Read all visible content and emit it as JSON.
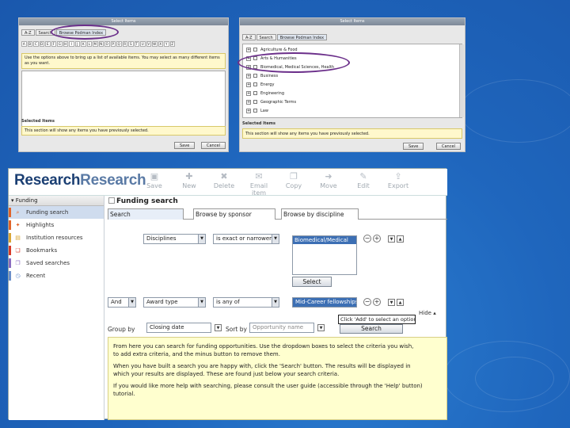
{
  "left_panel": {
    "title": "Select Items",
    "tabs": [
      "A-Z",
      "Search",
      "Browse Podman Index"
    ],
    "alphabet": [
      "A",
      "B",
      "C",
      "D",
      "E",
      "F",
      "G",
      "H",
      "I",
      "J",
      "K",
      "L",
      "M",
      "N",
      "O",
      "P",
      "Q",
      "R",
      "S",
      "T",
      "U",
      "V",
      "W",
      "X",
      "Y",
      "Z"
    ],
    "note": "Use the options above to bring up a list of available items. You may select as many different items as you want.",
    "selected_heading": "Selected Items",
    "selected_note": "This section will show any items you have previously selected.",
    "save_label": "Save",
    "cancel_label": "Cancel"
  },
  "right_panel": {
    "title": "Select Items",
    "tabs": [
      "A-Z",
      "Search",
      "Browse Podman Index"
    ],
    "tree_items": [
      "Agriculture & Food",
      "Arts & Humanities",
      "Biomedical, Medical Sciences, Health",
      "Business",
      "Energy",
      "Engineering",
      "Geographic Terms",
      "Law"
    ],
    "selected_heading": "Selected Items",
    "selected_note": "This section will show any items you have previously selected.",
    "save_label": "Save",
    "cancel_label": "Cancel"
  },
  "app": {
    "logo_main": "Research",
    "logo_second": "Research",
    "toolbar": [
      {
        "label": "Save",
        "icon": "save-icon",
        "glyph": "▣"
      },
      {
        "label": "New",
        "icon": "new-icon",
        "glyph": "✚"
      },
      {
        "label": "Delete",
        "icon": "delete-icon",
        "glyph": "✖"
      },
      {
        "label": "Email item",
        "icon": "email-icon",
        "glyph": "✉"
      },
      {
        "label": "Copy",
        "icon": "copy-icon",
        "glyph": "❐"
      },
      {
        "label": "Move",
        "icon": "move-icon",
        "glyph": "➜"
      },
      {
        "label": "Edit",
        "icon": "edit-icon",
        "glyph": "✎"
      },
      {
        "label": "Export",
        "icon": "export-icon",
        "glyph": "⇪"
      }
    ],
    "sidebar": {
      "heading": "Funding",
      "items": [
        {
          "label": "Funding search",
          "icon": "search-icon",
          "glyph": "⌕",
          "color": "#e0642a"
        },
        {
          "label": "Highlights",
          "icon": "highlight-icon",
          "glyph": "✦",
          "color": "#e0642a"
        },
        {
          "label": "Institution resources",
          "icon": "institution-icon",
          "glyph": "▤",
          "color": "#d8a636"
        },
        {
          "label": "Bookmarks",
          "icon": "bookmark-icon",
          "glyph": "❏",
          "color": "#d83b2a"
        },
        {
          "label": "Saved searches",
          "icon": "saved-search-icon",
          "glyph": "❐",
          "color": "#8b6cc0"
        },
        {
          "label": "Recent",
          "icon": "recent-icon",
          "glyph": "◷",
          "color": "#6b8fc9"
        }
      ]
    },
    "main": {
      "title": "Funding search",
      "tabs": [
        "Search",
        "Browse by sponsor",
        "Browse by discipline"
      ],
      "row1": {
        "field": "Disciplines",
        "operator": "is exact or narrower",
        "listbox_option": "Biomedical/Medical",
        "select_label": "Select"
      },
      "row2": {
        "conj": "And",
        "field": "Award type",
        "operator": "is any of",
        "value": "Mid-Career fellowships"
      },
      "tooltip": "Click 'Add' to select an option",
      "hide_label": "Hide",
      "group_by_label": "Group by",
      "group_by_value": "Closing date",
      "sort_by_label": "Sort by",
      "sort_by_value": "Opportunity name",
      "search_button": "Search",
      "info": [
        "From here you can search for funding opportunities. Use the dropdown boxes to select the criteria you wish,",
        "to add extra criteria, and the minus button to remove them.",
        "When you have built a search you are happy with, click the 'Search' button. The results will be displayed in",
        "which your results are displayed. These are found just below your search criteria.",
        "If you would like more help with searching, please consult the user guide (accessible through the 'Help' button)",
        "tutorial."
      ]
    }
  },
  "colors": {
    "annotation_oval": "#6b2f8a",
    "background": "#1f66bd",
    "accent": "#3c6fb4"
  }
}
